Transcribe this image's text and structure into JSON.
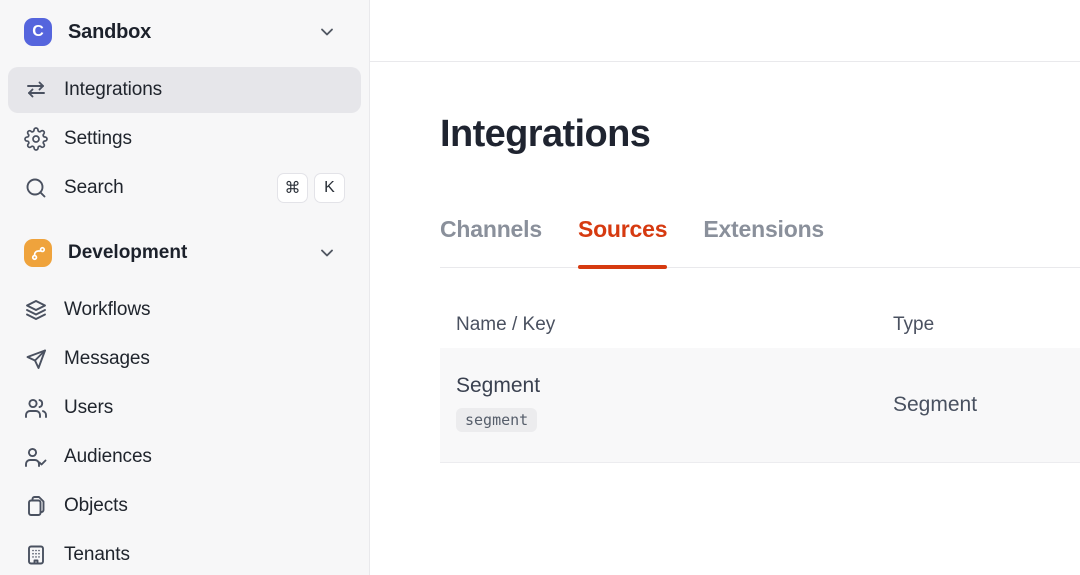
{
  "workspace": {
    "logo_letter": "C",
    "name": "Sandbox",
    "logo_icon": "workspace-logo",
    "chevron_icon": "chevron-down-icon"
  },
  "sidebar": {
    "items": [
      {
        "label": "Integrations",
        "icon": "swap-arrows-icon",
        "active": true
      },
      {
        "label": "Settings",
        "icon": "gear-icon",
        "active": false
      },
      {
        "label": "Search",
        "icon": "search-icon",
        "active": false,
        "shortcut": [
          "⌘",
          "K"
        ]
      }
    ],
    "section": {
      "name": "Development",
      "icon": "git-branch-icon",
      "chevron_icon": "chevron-down-icon"
    },
    "section_items": [
      {
        "label": "Workflows",
        "icon": "layers-icon"
      },
      {
        "label": "Messages",
        "icon": "send-icon"
      },
      {
        "label": "Users",
        "icon": "users-icon"
      },
      {
        "label": "Audiences",
        "icon": "user-check-icon"
      },
      {
        "label": "Objects",
        "icon": "copy-icon"
      },
      {
        "label": "Tenants",
        "icon": "building-icon"
      }
    ]
  },
  "main": {
    "title": "Integrations",
    "tabs": [
      {
        "label": "Channels",
        "active": false
      },
      {
        "label": "Sources",
        "active": true
      },
      {
        "label": "Extensions",
        "active": false
      }
    ],
    "table": {
      "columns": [
        "Name / Key",
        "Type"
      ],
      "rows": [
        {
          "name": "Segment",
          "key": "segment",
          "type": "Segment"
        }
      ]
    }
  },
  "colors": {
    "accent_red": "#D63A10",
    "brand_indigo": "#5565DD",
    "dev_orange": "#EFA33C",
    "sidebar_bg": "#F7F7F8",
    "selected_item_bg": "#E6E6EA",
    "row_bg": "#F8F8F9",
    "border": "#E9E9EC"
  }
}
